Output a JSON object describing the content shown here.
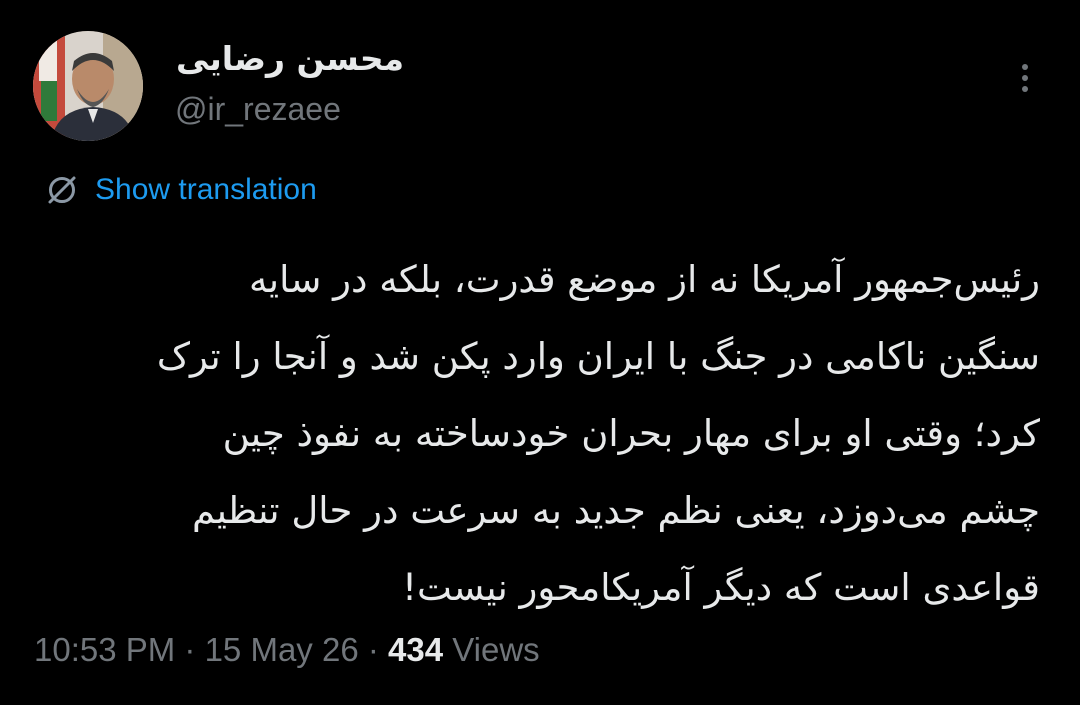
{
  "author": {
    "display_name": "محسن رضایی",
    "handle": "@ir_rezaee",
    "avatar_icon": "profile-photo"
  },
  "menu": {
    "more_icon": "more-vertical-icon"
  },
  "translation": {
    "icon": "globe-icon",
    "label": "Show translation",
    "color": "#1d9bf0"
  },
  "tweet": {
    "lines": [
      "رئیس‌جمهور آمریکا نه از موضع قدرت، بلکه در سایه",
      "سنگین ناکامی در جنگ با ایران وارد پکن شد و آنجا را ترک",
      "کرد؛ وقتی او برای مهار بحران خودساخته به نفوذ چین",
      "چشم می‌دوزد، یعنی نظم جدید به سرعت در حال تنظیم",
      "قواعدی است که دیگر آمریکامحور نیست!"
    ]
  },
  "meta": {
    "time": "10:53 PM",
    "separator": " · ",
    "date": "15 May 26",
    "views_count": "434",
    "views_label": " Views"
  },
  "colors": {
    "background": "#000000",
    "text_primary": "#e7e9ea",
    "text_secondary": "#71767b",
    "accent": "#1d9bf0"
  }
}
